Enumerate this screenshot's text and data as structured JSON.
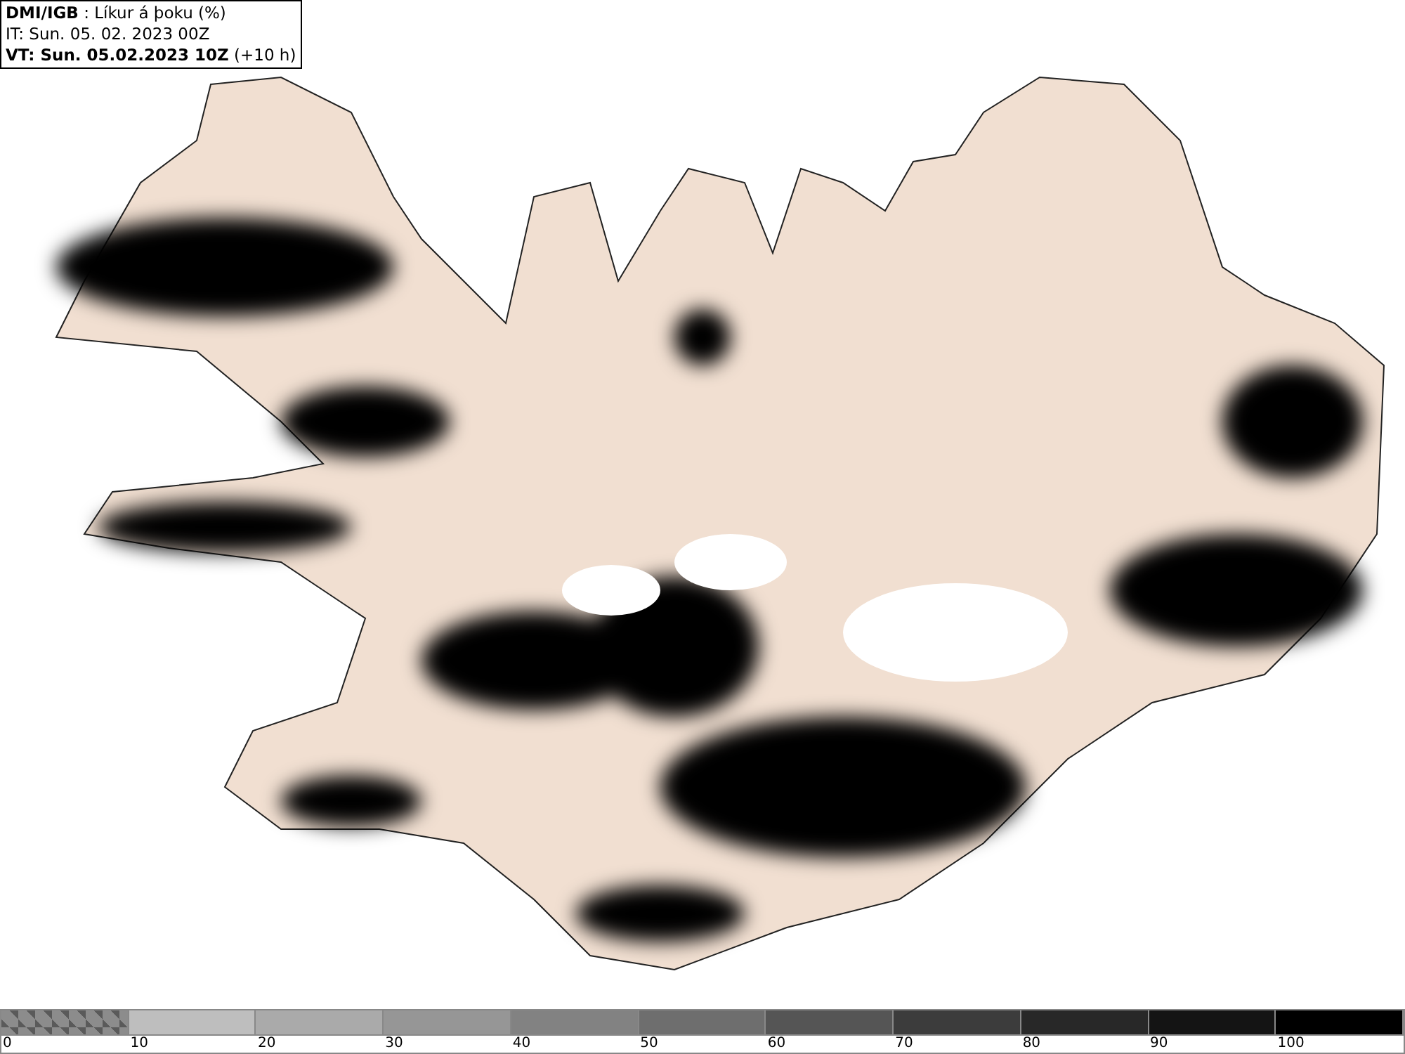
{
  "header": {
    "lines": [
      "**DMI/IGB** : Líkur á þoku (%)",
      "IT: Sun. 05. 02. 2023 00Z",
      "**VT: Sun. 05.02.2023 10Z** (+10 h)"
    ]
  },
  "legend": {
    "segments": [
      {
        "kind": "checkered",
        "color": "#8c8c8c"
      },
      {
        "kind": "solid",
        "color": "#bebebe"
      },
      {
        "kind": "solid",
        "color": "#aaaaaa"
      },
      {
        "kind": "solid",
        "color": "#969696"
      },
      {
        "kind": "solid",
        "color": "#828282"
      },
      {
        "kind": "solid",
        "color": "#6e6e6e"
      },
      {
        "kind": "solid",
        "color": "#555555"
      },
      {
        "kind": "solid",
        "color": "#3c3c3c"
      },
      {
        "kind": "solid",
        "color": "#282828"
      },
      {
        "kind": "solid",
        "color": "#141414"
      },
      {
        "kind": "solid",
        "color": "#000000"
      }
    ],
    "labels": [
      "0",
      "10",
      "20",
      "30",
      "40",
      "50",
      "60",
      "70",
      "80",
      "90",
      "100"
    ]
  }
}
